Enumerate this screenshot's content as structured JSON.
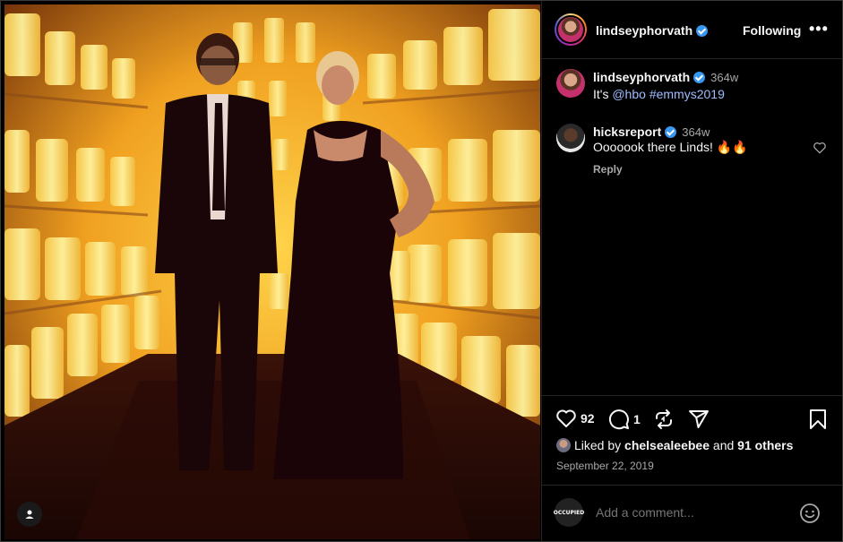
{
  "post": {
    "author": "lindseyphorvath",
    "verified": true,
    "follow_state": "Following",
    "more": "•••",
    "caption_author": "lindseyphorvath",
    "caption_time": "364w",
    "caption_prefix": "It's ",
    "caption_mention": "@hbo",
    "caption_hashtag": "#emmys2019"
  },
  "comments": [
    {
      "author": "hicksreport",
      "time": "364w",
      "text": "Ooooook there Linds! 🔥🔥",
      "reply_label": "Reply"
    }
  ],
  "actions": {
    "likes_count": "92",
    "comments_count": "1"
  },
  "liked_by": {
    "prefix": "Liked by ",
    "user": "chelsealeebee",
    "middle": " and ",
    "others": "91 others"
  },
  "date": "September 22, 2019",
  "add_comment": {
    "placeholder": "Add a comment...",
    "avatar_text": "OCCUPIED"
  },
  "icons": {
    "like": "heart-icon",
    "comment": "speech-bubble-icon",
    "repost": "repost-icon",
    "share": "paper-plane-icon",
    "save": "bookmark-icon",
    "emoji": "smiley-icon",
    "tag": "user-tag-icon"
  },
  "colors": {
    "link": "#a0bcff",
    "verified": "#3897f0",
    "muted": "#a8a8a8",
    "background": "#000000"
  }
}
